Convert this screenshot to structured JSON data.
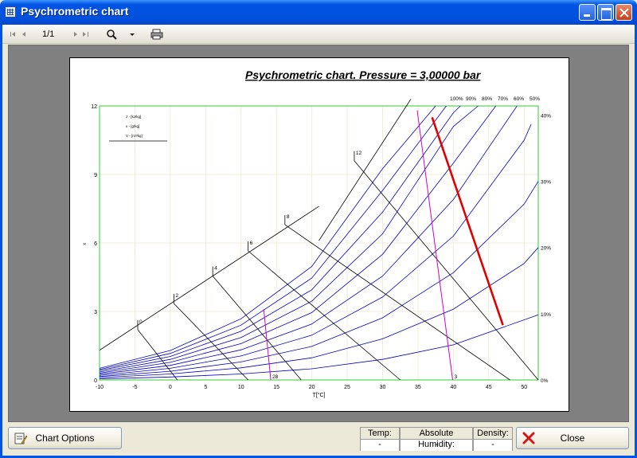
{
  "window": {
    "title": "Psychrometric chart",
    "icon": "chart-grid-icon"
  },
  "toolbar": {
    "page_indicator": "1/1",
    "icons": [
      "first-page-icon",
      "prev-page-icon",
      "next-page-icon",
      "last-page-icon",
      "zoom-icon",
      "zoom-dropdown-icon",
      "print-icon"
    ]
  },
  "chart_data": {
    "type": "line",
    "title": "Psychrometric chart. Pressure = 3,00000 bar",
    "xlabel": "T[°C]",
    "ylabel": "x",
    "xlim": [
      -10,
      52
    ],
    "ylim": [
      0,
      12
    ],
    "x_ticks": [
      "-10",
      "-5",
      "0",
      "5",
      "10",
      "15",
      "20",
      "25",
      "30",
      "35",
      "40",
      "45",
      "50"
    ],
    "y_ticks": [
      "0",
      "3",
      "6",
      "9",
      "12"
    ],
    "rh_axis_ticks": [
      "0%",
      "10%",
      "20%",
      "30%",
      "40%"
    ],
    "rh_top_labels": [
      "100%",
      "90%",
      "80%",
      "70%",
      "60%",
      "50%"
    ],
    "legend_lines": [
      "J - [kJ/kg]",
      "x - [g/kg]",
      "V - [m³/kg]"
    ],
    "relative_humidity_curves": [
      {
        "rh": 10,
        "color": "#0000c0",
        "x": [
          -10,
          0,
          10,
          20,
          30,
          40,
          52
        ],
        "y": [
          0.05,
          0.13,
          0.26,
          0.49,
          0.9,
          1.54,
          2.85
        ]
      },
      {
        "rh": 20,
        "color": "#0000c0",
        "x": [
          -10,
          0,
          10,
          20,
          30,
          40,
          50,
          52
        ],
        "y": [
          0.1,
          0.26,
          0.53,
          0.97,
          1.8,
          3.1,
          5.1,
          5.8
        ]
      },
      {
        "rh": 30,
        "color": "#0000c0",
        "x": [
          -10,
          0,
          10,
          20,
          30,
          40,
          50,
          52
        ],
        "y": [
          0.15,
          0.38,
          0.79,
          1.47,
          2.72,
          4.7,
          7.7,
          8.7
        ]
      },
      {
        "rh": 40,
        "color": "#0000c0",
        "x": [
          -10,
          0,
          10,
          20,
          30,
          40,
          50,
          51
        ],
        "y": [
          0.2,
          0.51,
          1.05,
          1.96,
          3.63,
          6.3,
          10.5,
          11.2
        ]
      },
      {
        "rh": 50,
        "color": "#0000c0",
        "x": [
          -10,
          0,
          10,
          20,
          30,
          40,
          49
        ],
        "y": [
          0.25,
          0.64,
          1.32,
          2.45,
          4.55,
          7.9,
          12.0
        ]
      },
      {
        "rh": 60,
        "color": "#0000c0",
        "x": [
          -10,
          0,
          10,
          20,
          30,
          40,
          46
        ],
        "y": [
          0.3,
          0.77,
          1.59,
          2.95,
          5.5,
          9.5,
          12.0
        ]
      },
      {
        "rh": 70,
        "color": "#0000c0",
        "x": [
          -10,
          0,
          10,
          20,
          30,
          40,
          43.5
        ],
        "y": [
          0.35,
          0.9,
          1.86,
          3.45,
          6.4,
          11.1,
          12.0
        ]
      },
      {
        "rh": 80,
        "color": "#0000c0",
        "x": [
          -10,
          0,
          10,
          20,
          30,
          40,
          41
        ],
        "y": [
          0.41,
          1.03,
          2.13,
          3.95,
          7.35,
          11.7,
          12.0
        ]
      },
      {
        "rh": 90,
        "color": "#0000c0",
        "x": [
          -10,
          0,
          10,
          20,
          30,
          39
        ],
        "y": [
          0.46,
          1.16,
          2.4,
          4.46,
          8.3,
          12.0
        ]
      },
      {
        "rh": 100,
        "color": "#0000c0",
        "x": [
          -10,
          0,
          10,
          20,
          30,
          37.5
        ],
        "y": [
          0.51,
          1.29,
          2.68,
          4.97,
          9.25,
          12.0
        ]
      }
    ],
    "enthalpy_lines": {
      "color": "#000000",
      "labels": [
        "0",
        "2",
        "4",
        "6",
        "8",
        "12"
      ],
      "lines": [
        {
          "x": [
            -4.6,
            1
          ],
          "y": [
            2.2,
            0
          ]
        },
        {
          "x": [
            0.5,
            11
          ],
          "y": [
            3.35,
            0
          ]
        },
        {
          "x": [
            6,
            18.5
          ],
          "y": [
            4.55,
            0
          ]
        },
        {
          "x": [
            11,
            32.5
          ],
          "y": [
            5.65,
            0
          ]
        },
        {
          "x": [
            16.2,
            48
          ],
          "y": [
            6.8,
            0
          ]
        },
        {
          "x": [
            26,
            52
          ],
          "y": [
            9.6,
            0
          ]
        }
      ]
    },
    "saturation_line": {
      "color": "#000000",
      "x": [
        -10,
        21
      ],
      "y": [
        1.3,
        7.6
      ]
    },
    "enthalpy_upper_line": {
      "color": "#000000",
      "x": [
        21,
        34
      ],
      "y": [
        6.1,
        12.3
      ]
    },
    "volume_lines": {
      "color": "#d000d0",
      "labels": [
        "28",
        "3"
      ],
      "lines": [
        {
          "x": [
            13.2,
            14.2
          ],
          "y": [
            3.1,
            0
          ]
        },
        {
          "x": [
            34.9,
            39.9
          ],
          "y": [
            11.8,
            0
          ]
        }
      ]
    },
    "process_line": {
      "color": "#e00000",
      "x": [
        37,
        47
      ],
      "y": [
        11.5,
        2.4
      ]
    },
    "grid": true,
    "legend_position": "top-left"
  },
  "bottom": {
    "chart_options_label": "Chart Options",
    "close_label": "Close",
    "readouts": [
      {
        "label": "Temp:",
        "value": "-"
      },
      {
        "label": "Absolute Humidity:",
        "value": "-"
      },
      {
        "label": "Density:",
        "value": "-"
      }
    ]
  }
}
